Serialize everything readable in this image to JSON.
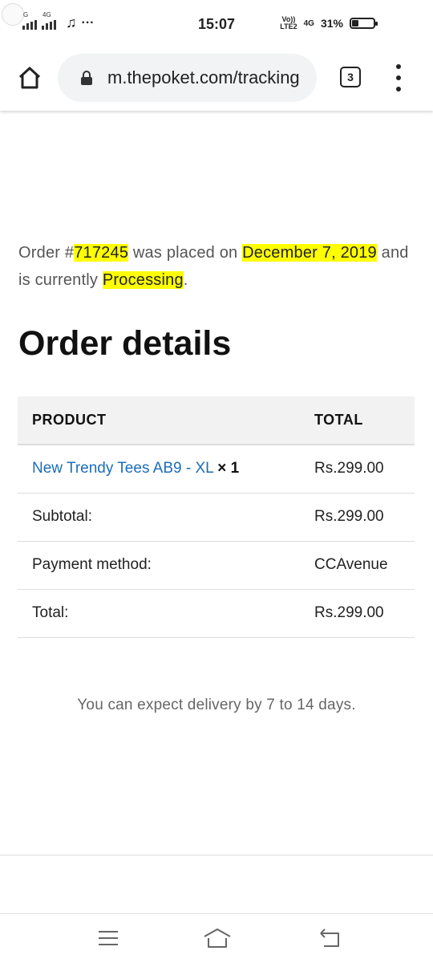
{
  "status_bar": {
    "time": "15:07",
    "network_left": [
      "G",
      "4G"
    ],
    "volte_label": "Vo))\nLTE2",
    "net_type": "4G",
    "battery_percent": "31%",
    "battery_level": 0.31
  },
  "browser": {
    "url": "m.thepoket.com/tracking",
    "tab_count": "3"
  },
  "order": {
    "prefix": "Order #",
    "number": "717245",
    "placed_text": " was placed on ",
    "date": "December 7, 2019",
    "status_text": " and is currently ",
    "status": "Processing",
    "suffix": "."
  },
  "order_details": {
    "heading": "Order details",
    "columns": [
      "PRODUCT",
      "TOTAL"
    ],
    "product": {
      "name": "New Trendy Tees AB9 - XL",
      "qty": "× 1",
      "total": "Rs.299.00"
    },
    "rows": [
      {
        "label": "Subtotal:",
        "value": "Rs.299.00"
      },
      {
        "label": "Payment method:",
        "value": "CCAvenue"
      },
      {
        "label": "Total:",
        "value": "Rs.299.00"
      }
    ]
  },
  "delivery_note": "You can expect delivery by 7 to 14 days.",
  "nav_icons": [
    "menu-icon",
    "home-icon",
    "back-icon"
  ]
}
